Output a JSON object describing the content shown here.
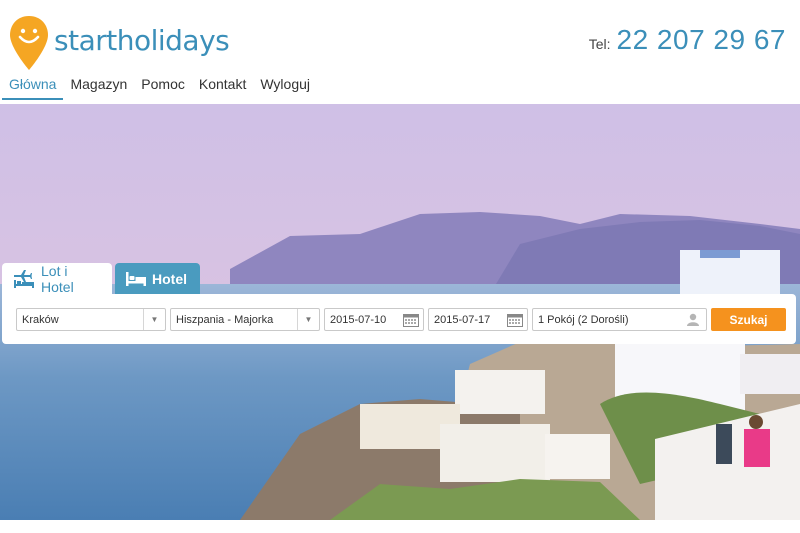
{
  "brand": {
    "name": "startholidays",
    "color": "#3b8fb9",
    "logo_icon": "smiley-pin-icon"
  },
  "contact": {
    "phone_label": "Tel:",
    "phone_number": "22 207 29 67"
  },
  "nav": {
    "items": [
      {
        "label": "Główna",
        "active": true
      },
      {
        "label": "Magazyn",
        "active": false
      },
      {
        "label": "Pomoc",
        "active": false
      },
      {
        "label": "Kontakt",
        "active": false
      },
      {
        "label": "Wyloguj",
        "active": false
      }
    ]
  },
  "search": {
    "tabs": [
      {
        "label": "Lot i Hotel",
        "icon": "plane-bed-icon",
        "active": true
      },
      {
        "label": "Hotel",
        "icon": "bed-icon",
        "active": false
      }
    ],
    "from": "Kraków",
    "destination": "Hiszpania - Majorka",
    "date_from": "2015-07-10",
    "date_to": "2015-07-17",
    "rooms": "1 Pokój (2 Dorośli)",
    "submit_label": "Szukaj",
    "submit_color": "#f5921e"
  }
}
